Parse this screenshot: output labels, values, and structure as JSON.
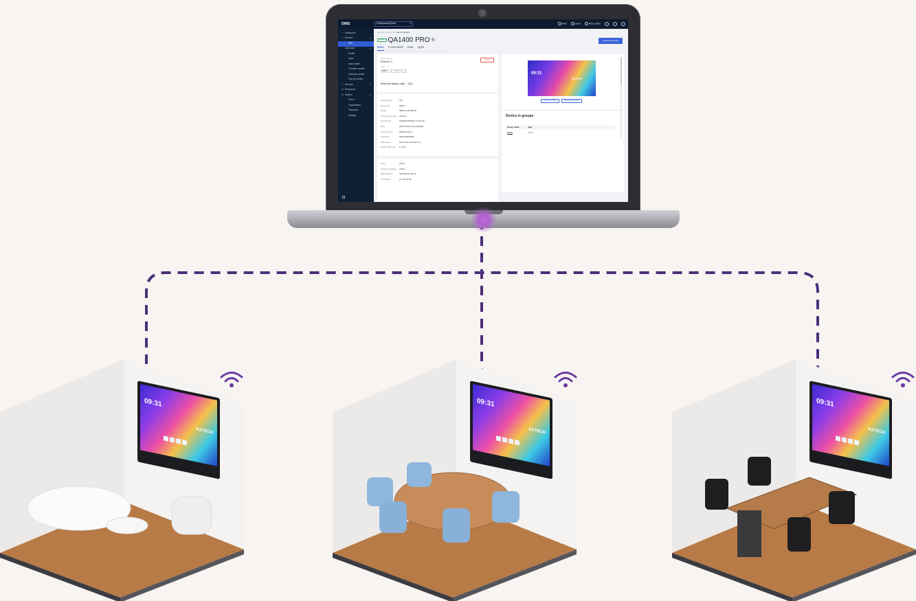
{
  "app": {
    "logo": "DMS",
    "org_select": "SZ&AplanningTeam",
    "topbar_items": [
      "Alert",
      "Cloud",
      "Help Center"
    ]
  },
  "sidebar": {
    "items": [
      {
        "label": "Dashboard",
        "sym": "◇"
      },
      {
        "label": "Devices",
        "sym": "▢",
        "caret": "▴"
      },
      {
        "label": "BTF",
        "active": true,
        "sub": true
      },
      {
        "label": "Advanced",
        "sym": "☆",
        "caret": "▴"
      },
      {
        "label": "Profile",
        "sub": true
      },
      {
        "label": "Apps",
        "sub": true
      },
      {
        "label": "Input switch",
        "sub": true
      },
      {
        "label": "Firmware update",
        "sub": true
      },
      {
        "label": "Software update",
        "sub": true
      },
      {
        "label": "Pop-up blocker",
        "sub": true
      },
      {
        "label": "Records",
        "sym": "▭",
        "caret": "▾"
      },
      {
        "label": "Resources",
        "sym": "⊞"
      },
      {
        "label": "System",
        "sym": "⚙",
        "caret": "▴"
      },
      {
        "label": "Users",
        "sub": true
      },
      {
        "label": "Organization",
        "sub": true
      },
      {
        "label": "Password",
        "sub": true
      },
      {
        "label": "Settings",
        "sub": true
      }
    ]
  },
  "page": {
    "breadcrumb_prefix": "Devices / Group 1A /",
    "breadcrumb_current": "Device details",
    "status_badge": "Online",
    "title": "QA1400 PRO",
    "send_command": "Send Command",
    "tabs": [
      "Basic",
      "Commands",
      "Data",
      "Apps"
    ]
  },
  "basic_card": {
    "device_name_label": "Device name",
    "device_name": "RZTech1 ✎",
    "tags_label": "Tags",
    "tag": "BKB ×",
    "add_tag": "+ Add new",
    "unbind": "Unbind",
    "realtime_label": "Real-time display notify"
  },
  "info_rows": [
    {
      "k": "Device Type",
      "v": "IFP"
    },
    {
      "k": "Device ID",
      "v": "29067"
    },
    {
      "k": "Model",
      "v": "86BCC1C02500-B"
    },
    {
      "k": "Operating System",
      "v": "Android"
    },
    {
      "k": "OS Version",
      "v": "SQD0011P20033, 10.00.00"
    },
    {
      "k": "CPU",
      "v": "ARM architecture(ARM64)"
    },
    {
      "k": "Touch Frame",
      "v": "8ZDA01C02-1"
    },
    {
      "k": "Serial No.",
      "v": "6600100000000"
    },
    {
      "k": "OTA server",
      "v": "https://ota.example.com"
    },
    {
      "k": "Mysny DMS ver.",
      "v": "1.10.12"
    }
  ],
  "network_rows": [
    {
      "k": "Wi-Fi",
      "v": "AUTO"
    },
    {
      "k": "Network interface",
      "v": "wlan0"
    },
    {
      "k": "Mac Address",
      "v": "33:58:58:43:4E:7F"
    },
    {
      "k": "IP Address",
      "v": "27.151.32.86"
    }
  ],
  "preview": {
    "clock": "09:31",
    "brand": "RZTECH",
    "screen_control": "Screen control",
    "realtime_display": "Real-time display"
  },
  "groups": {
    "title": "Device in groups",
    "col_group": "Group name",
    "col_tags": "Tags",
    "row_group": "BKKB",
    "row_tags": "BKKB"
  },
  "rooms": [
    {
      "name": "lounge",
      "clock": "09:31",
      "label": "RZTECH"
    },
    {
      "name": "meeting-room",
      "clock": "09:31",
      "label": "RZTECH"
    },
    {
      "name": "boardroom",
      "clock": "09:31",
      "label": "RZTECH"
    }
  ],
  "colors": {
    "background": "#f8f4f2",
    "line": "#4a2f78",
    "accent": "#3b64d8",
    "wifi": "#6a3aa0"
  }
}
